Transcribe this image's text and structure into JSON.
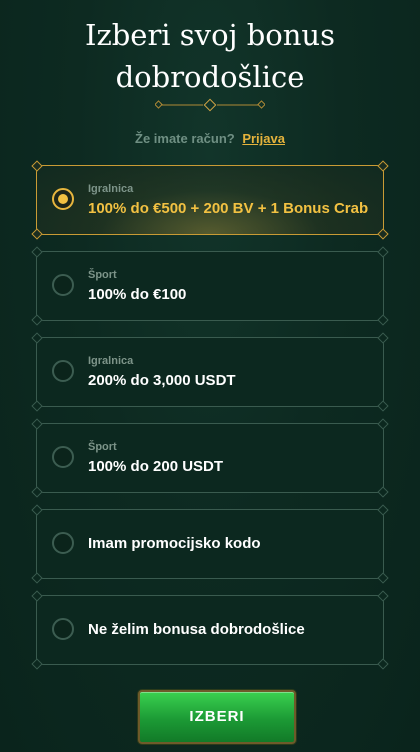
{
  "header": {
    "title_line1": "Izberi svoj bonus",
    "title_line2": "dobrodošlice"
  },
  "login": {
    "prompt": "Že imate račun?",
    "link": "Prijava"
  },
  "options": [
    {
      "category": "Igralnica",
      "label": "100% do €500 + 200 BV + 1 Bonus Crab",
      "selected": true
    },
    {
      "category": "Šport",
      "label": "100% do €100",
      "selected": false
    },
    {
      "category": "Igralnica",
      "label": "200% do 3,000 USDT",
      "selected": false
    },
    {
      "category": "Šport",
      "label": "100% do 200 USDT",
      "selected": false
    },
    {
      "category": "",
      "label": "Imam promocijsko kodo",
      "selected": false
    },
    {
      "category": "",
      "label": "Ne želim bonusa dobrodošlice",
      "selected": false
    }
  ],
  "submit": {
    "label": "IZBERI"
  },
  "colors": {
    "accent_gold": "#f2c142",
    "button_green": "#23b03e",
    "background": "#0d2a21"
  }
}
